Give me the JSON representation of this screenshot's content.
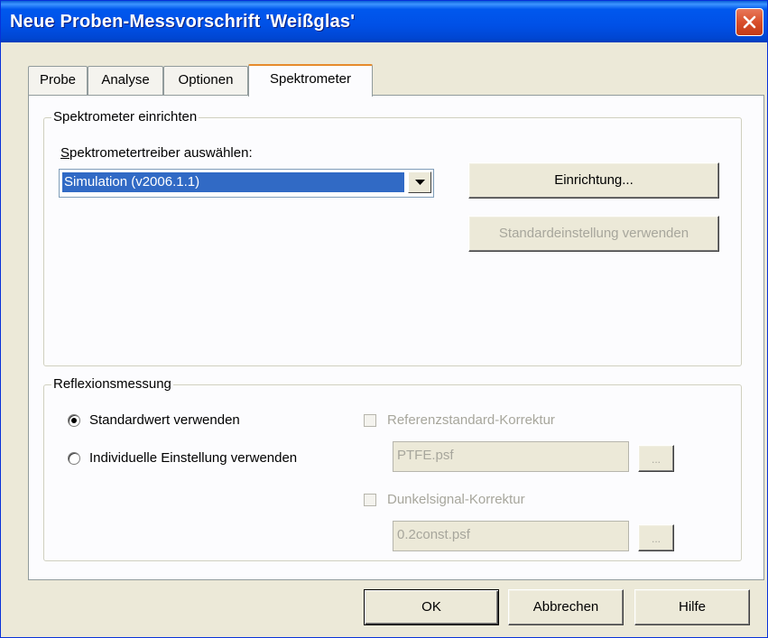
{
  "window": {
    "title": "Neue Proben-Messvorschrift 'Weißglas'"
  },
  "tabs": [
    {
      "label": "Probe"
    },
    {
      "label": "Analyse"
    },
    {
      "label": "Optionen"
    },
    {
      "label": "Spektrometer"
    }
  ],
  "spektrometer_group": {
    "title": "Spektrometer einrichten",
    "driver_label": "Spektrometertreiber auswählen:",
    "driver_value": "Simulation (v2006.1.1)",
    "setup_button": "Einrichtung...",
    "default_button": "Standardeinstellung verwenden"
  },
  "reflexion_group": {
    "title": "Reflexionsmessung",
    "radio_standard": "Standardwert verwenden",
    "radio_individual": "Individuelle Einstellung verwenden",
    "selected_radio": "standard",
    "ref_checkbox_label": "Referenzstandard-Korrektur",
    "ref_file": "PTFE.psf",
    "dark_checkbox_label": "Dunkelsignal-Korrektur",
    "dark_file": "0.2const.psf",
    "browse_label": "..."
  },
  "footer": {
    "ok": "OK",
    "cancel": "Abbrechen",
    "help": "Hilfe"
  },
  "colors": {
    "titlebar": "#0050e6",
    "dialog_bg": "#ece9d8",
    "selection": "#316ac5",
    "tab_highlight": "#e68b2c",
    "disabled_text": "#a7a69c"
  }
}
